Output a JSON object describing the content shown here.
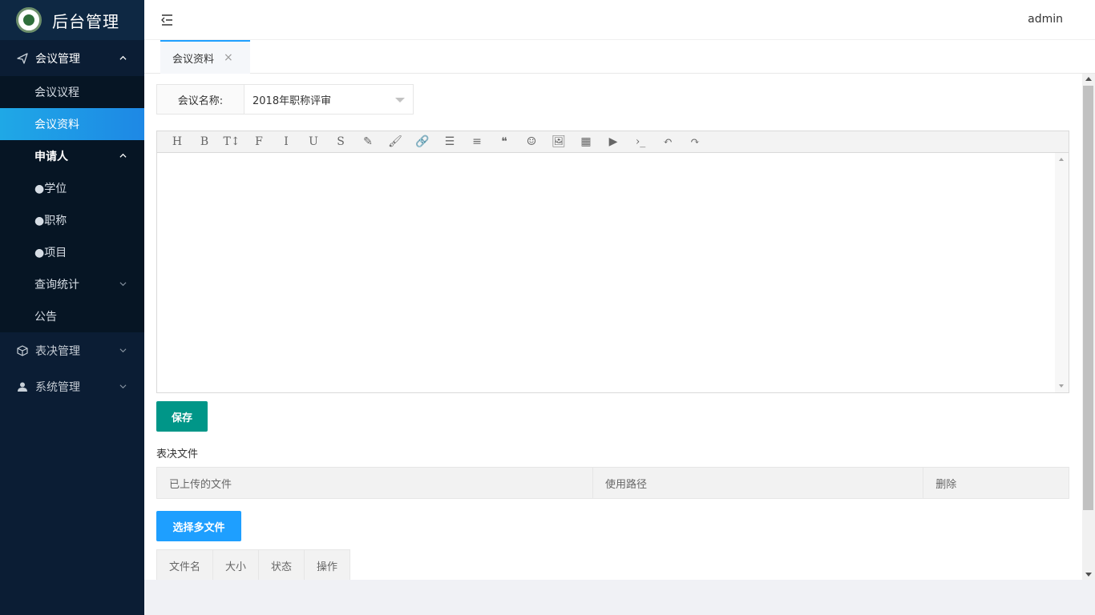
{
  "app": {
    "title": "后台管理",
    "user": "admin"
  },
  "sidebar": {
    "groups": [
      {
        "label": "会议管理",
        "icon": "send-icon",
        "expanded": true
      },
      {
        "label": "表决管理",
        "icon": "cube-icon",
        "expanded": false
      },
      {
        "label": "系统管理",
        "icon": "user-icon",
        "expanded": false
      }
    ],
    "meeting_items": [
      {
        "label": "会议议程"
      },
      {
        "label": "会议资料",
        "active": true
      },
      {
        "label": "申请人"
      },
      {
        "label": "●学位"
      },
      {
        "label": "●职称"
      },
      {
        "label": "●项目"
      },
      {
        "label": "查询统计"
      },
      {
        "label": "公告"
      }
    ]
  },
  "tabs": [
    {
      "label": "会议资料",
      "close": "×"
    }
  ],
  "form": {
    "meeting_label": "会议名称:",
    "meeting_value": "2018年职称评审"
  },
  "editor": {
    "tools": [
      "H",
      "B",
      "T↕",
      "F",
      "I",
      "U",
      "S",
      "✎",
      "🖌",
      "🔗",
      "☰",
      "≡",
      "❝",
      "☺",
      "🖼",
      "▦",
      "▶",
      "›_",
      "↶",
      "↷"
    ]
  },
  "buttons": {
    "save": "保存",
    "select_multi": "选择多文件"
  },
  "files_section": {
    "title": "表决文件",
    "columns": [
      "已上传的文件",
      "使用路径",
      "删除"
    ]
  },
  "queue_table": {
    "columns": [
      "文件名",
      "大小",
      "状态",
      "操作"
    ]
  },
  "colors": {
    "sidebar": "#0b1d34",
    "active": "#1e9fff",
    "save": "#009688"
  }
}
